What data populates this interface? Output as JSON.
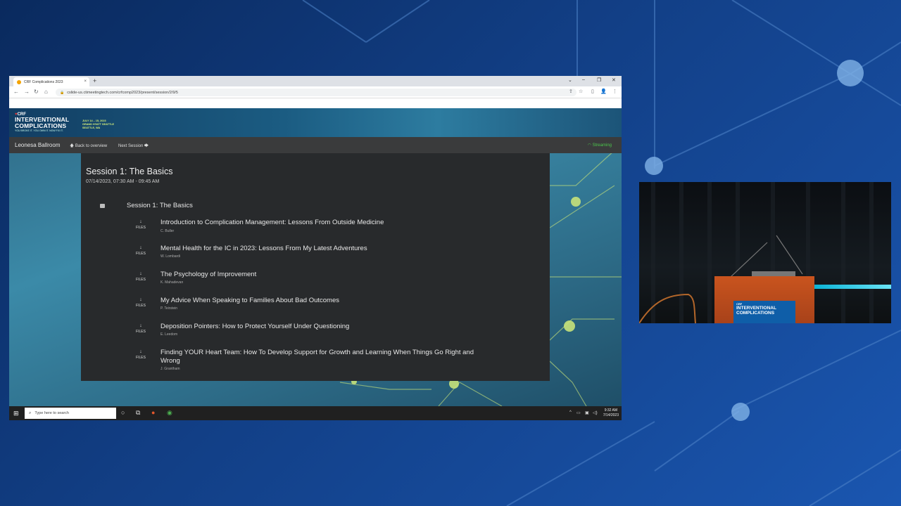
{
  "browser": {
    "tab_title": "CRF Complications 2023",
    "tab_close": "×",
    "new_tab": "+",
    "url": "cslide-us.ctimeetingtech.com/crfcomp2023/present/session/2/9/5",
    "win_controls": [
      "⌄",
      "–",
      "❐",
      "✕"
    ],
    "nav_icons": [
      "←",
      "→",
      "↻",
      "⌂"
    ],
    "toolbar_icons": [
      "⇪",
      "☆",
      "▯",
      "👤",
      "⋮"
    ]
  },
  "banner": {
    "brand": "CRF",
    "line1": "INTERVENTIONAL",
    "line2": "COMPLICATIONS",
    "tagline": "YOU BROKE IT. YOU OWN IT. NOW FIX IT.",
    "dates": "JULY 14 – 15, 2023",
    "venue": "GRAND HYATT SEATTLE",
    "city": "SEATTLE, WA"
  },
  "subnav": {
    "room": "Leonesa Ballroom",
    "back": "Back to overview",
    "next": "Next Session",
    "streaming": "Streaming"
  },
  "session": {
    "title": "Session 1: The Basics",
    "time": "07/14/2023, 07:30 AM - 09:45 AM",
    "heading": "Session 1: The Basics",
    "files_label": "FILES",
    "files_arrow": "↓",
    "talks": [
      {
        "title": "Introduction to Complication Management: Lessons From Outside Medicine",
        "author": "C. Buller"
      },
      {
        "title": "Mental Health for the IC in 2023: Lessons From My Latest Adventures",
        "author": "W. Lombardi"
      },
      {
        "title": "The Psychology of Improvement",
        "author": "K. Mahadevan"
      },
      {
        "title": "My Advice When Speaking to Families About Bad Outcomes",
        "author": "P. Teirstein"
      },
      {
        "title": "Deposition Pointers: How to Protect Yourself Under Questioning",
        "author": "E. Leedom"
      },
      {
        "title": "Finding YOUR Heart Team: How To Develop Support for Growth and Learning When Things Go Right and Wrong",
        "author": "J. Grantham"
      }
    ]
  },
  "taskbar": {
    "search_placeholder": "Type here to search",
    "time": "9:32 AM",
    "date": "7/14/2023"
  },
  "video": {
    "screen_brand": "CRF",
    "screen_line1": "INTERVENTIONAL",
    "screen_line2": "COMPLICATIONS"
  },
  "colors": {
    "background": "#123f86",
    "panel": "#282a2c",
    "subnav": "#3a3b3c",
    "streaming": "#4cc74c",
    "accent_green": "#c6e27a"
  }
}
